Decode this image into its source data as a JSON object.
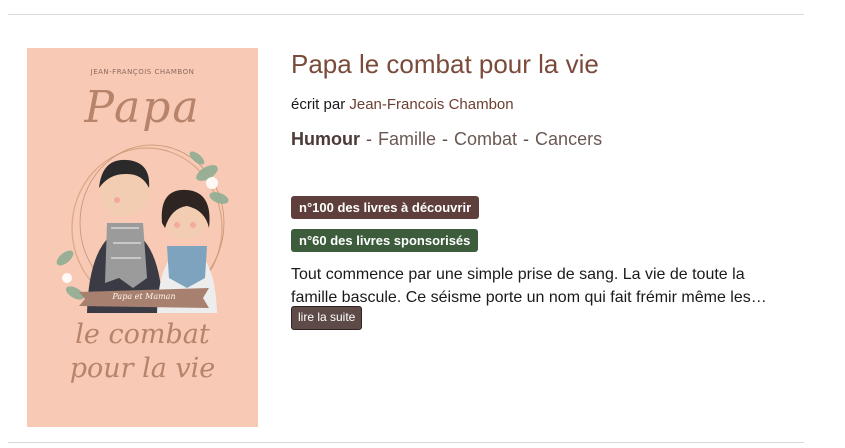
{
  "book": {
    "cover": {
      "author_caps": "JEAN-FRANÇOIS CHAMBON",
      "title_top": "Papa",
      "title_bottom_1": "le combat",
      "title_bottom_2": "pour la vie",
      "ribbon_text": "Papa et Maman"
    },
    "title": "Papa le combat pour la vie",
    "byline_prefix": "écrit par",
    "author": "Jean-Francois Chambon",
    "genres": {
      "main": "Humour",
      "items": [
        "Famille",
        "Combat",
        "Cancers"
      ],
      "separator": "-"
    },
    "badges": [
      {
        "label": "n°100 des livres à découvrir",
        "color": "#5e3f3b"
      },
      {
        "label": "n°60 des livres sponsorisés",
        "color": "#3c5c3b"
      }
    ],
    "description": "Tout commence par une simple prise de sang. La vie de toute la famille bascule. Ce séisme porte un nom qui fait frémir même les…",
    "read_more": "lire la suite"
  },
  "colors": {
    "title": "#7a4a3a",
    "cover_bg": "#f8c9b4"
  }
}
